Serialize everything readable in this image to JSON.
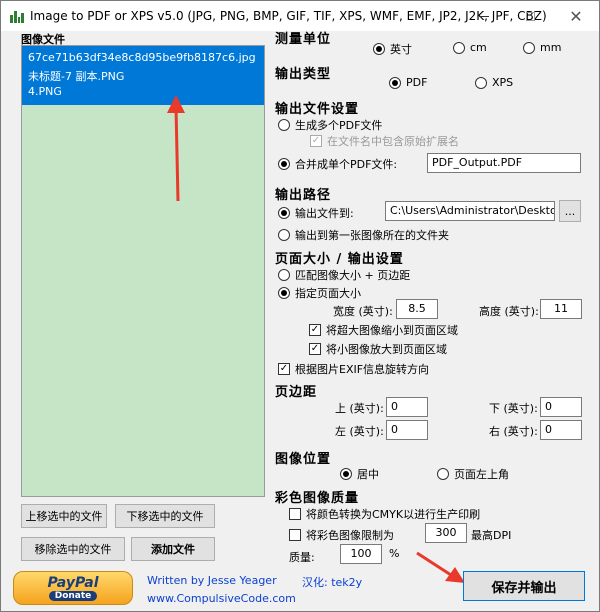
{
  "window": {
    "title": "Image to PDF or XPS  v5.0  (JPG, PNG, BMP, GIF, TIF, XPS, WMF, EMF, JP2, J2K, JPF, CBZ)"
  },
  "files": {
    "header": "图像文件",
    "items": [
      "67ce71b63df34e8c8d95be9fb8187c6.jpg",
      "未标题-7 副本.PNG",
      "4.PNG"
    ]
  },
  "buttons": {
    "move_up": "上移选中的文件",
    "move_down": "下移选中的文件",
    "remove": "移除选中的文件",
    "add": "添加文件",
    "browse": "...",
    "save": "保存并输出"
  },
  "units": {
    "header": "测量单位",
    "options": [
      "英寸",
      "cm",
      "mm"
    ],
    "selected": "英寸"
  },
  "output_type": {
    "header": "输出类型",
    "options": [
      "PDF",
      "XPS"
    ],
    "selected": "PDF"
  },
  "output_file": {
    "header": "输出文件设置",
    "multi_pdf": "生成多个PDF文件",
    "include_ext": "在文件名中包含原始扩展名",
    "single_pdf": "合并成单个PDF文件:",
    "filename": "PDF_Output.PDF"
  },
  "output_path": {
    "header": "输出路径",
    "to_folder": "输出文件到:",
    "folder": "C:\\Users\\Administrator\\Desktop",
    "first_image_folder": "输出到第一张图像所在的文件夹"
  },
  "page_size": {
    "header": "页面大小 / 输出设置",
    "match_image": "匹配图像大小 + 页边距",
    "specify": "指定页面大小",
    "width_label": "宽度 (英寸):",
    "width": "8.5",
    "height_label": "高度 (英寸):",
    "height": "11",
    "shrink_large": "将超大图像缩小到页面区域",
    "enlarge_small": "将小图像放大到页面区域",
    "exif_rotate": "根据图片EXIF信息旋转方向"
  },
  "margins": {
    "header": "页边距",
    "top_label": "上 (英寸):",
    "top": "0",
    "bottom_label": "下 (英寸):",
    "bottom": "0",
    "left_label": "左 (英寸):",
    "left": "0",
    "right_label": "右 (英寸):",
    "right": "0"
  },
  "image_position": {
    "header": "图像位置",
    "center": "居中",
    "top_left": "页面左上角"
  },
  "color_quality": {
    "header": "彩色图像质量",
    "cmyk": "将颜色转换为CMYK以进行生产印刷",
    "limit": "将彩色图像限制为",
    "dpi": "300",
    "dpi_label": "最高DPI",
    "quality_label": "质量:",
    "quality": "100",
    "percent": "%"
  },
  "footer": {
    "paypal_text": "PayPal",
    "donate_text": "Donate",
    "author": "Written by Jesse Yeager",
    "localizer": "汉化: tek2y",
    "website": "www.CompulsiveCode.com"
  },
  "colors": {
    "selection": "#0078d7",
    "list_bg": "#c6e4c6",
    "arrow": "#e8392b",
    "link": "#0a3fd1"
  }
}
